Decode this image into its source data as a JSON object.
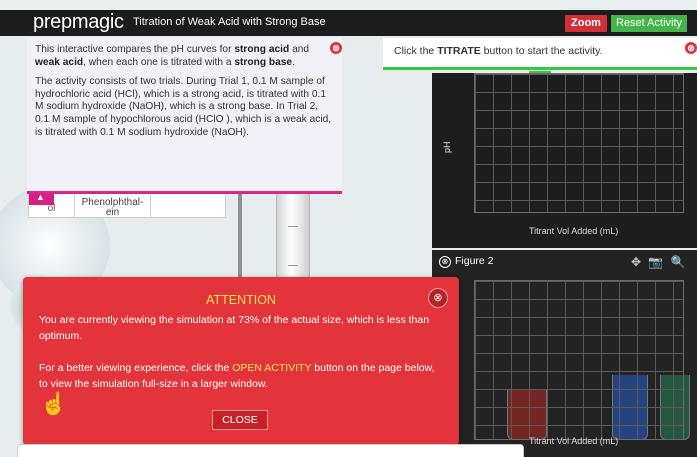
{
  "header": {
    "logo": "prepmagic",
    "title": "Titration of Weak Acid with Strong Base",
    "zoom_label": "Zoom",
    "reset_label": "Reset Activity"
  },
  "intro": {
    "p1_a": "This interactive compares the pH curves for ",
    "p1_b": "strong acid",
    "p1_c": " and ",
    "p1_d": "weak acid",
    "p1_e": ", when each one is titrated with a ",
    "p1_f": "strong base",
    "p1_g": ".",
    "p2": "The activity consists of two trials. During Trial 1, 0.1 M sample of hydrochloric acid (HCl), which is a strong acid, is titrated with 0.1 M sodium hydroxide (NaOH), which is a strong base. In Trial 2, 0.1 M sample of hypochlorous acid (HClO ), which is a weak acid, is titrated with 0.1 M sodium hydroxide (NaOH).",
    "close_icon": "⊗"
  },
  "data_table": {
    "cell1": "ol",
    "cell2": "Phenolphthal-\nein",
    "collapse_icon": "▲"
  },
  "instructions": {
    "text_a": "Click the ",
    "text_b": "TITRATE",
    "text_c": " button to start the activity.",
    "close_icon": "⊗",
    "expand_icon": "▲"
  },
  "graph1": {
    "ylabel": "pH",
    "xlabel": "Titrant Vol Added (mL)"
  },
  "graph2": {
    "close_icon": "⊗",
    "figure_label": "Figure 2",
    "xlabel": "Titrant Vol Added (mL)",
    "tools": [
      "✥",
      "📷",
      "🔍"
    ]
  },
  "attention": {
    "heading": "ATTENTION",
    "line1": "You are currently viewing the simulation at 73% of the actual size, which is less than optimum.",
    "line2_a": "For a better viewing experience, click the ",
    "line2_b": "OPEN ACTIVITY",
    "line2_c": " button on the page below, to view the simulation full-size in a larger window.",
    "close_icon": "⊗",
    "close_label": "CLOSE",
    "hand_icon": "☝"
  }
}
